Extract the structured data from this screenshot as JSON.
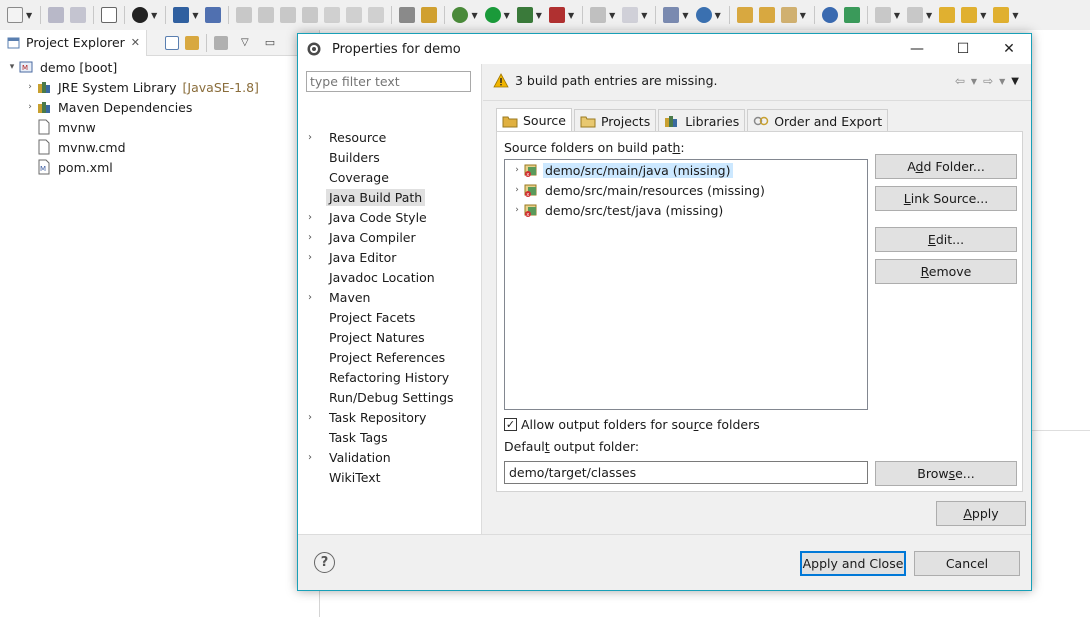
{
  "explorer": {
    "tab_title": "Project Explorer",
    "items": [
      {
        "label": "demo [boot]",
        "suffix": "",
        "level": 0,
        "expanded": true,
        "icon": "maven-project-icon"
      },
      {
        "label": "JRE System Library",
        "suffix": "[JavaSE-1.8]",
        "level": 1,
        "expanded": false,
        "icon": "library-icon"
      },
      {
        "label": "Maven Dependencies",
        "suffix": "",
        "level": 1,
        "expanded": false,
        "icon": "library-icon"
      },
      {
        "label": "mvnw",
        "suffix": "",
        "level": 1,
        "expanded": null,
        "icon": "file-icon"
      },
      {
        "label": "mvnw.cmd",
        "suffix": "",
        "level": 1,
        "expanded": null,
        "icon": "file-icon"
      },
      {
        "label": "pom.xml",
        "suffix": "",
        "level": 1,
        "expanded": null,
        "icon": "xml-file-icon"
      }
    ]
  },
  "dialog": {
    "title": "Properties for demo",
    "filter_placeholder": "type filter text",
    "nav": [
      {
        "label": "Resource",
        "expandable": true
      },
      {
        "label": "Builders",
        "expandable": false
      },
      {
        "label": "Coverage",
        "expandable": false
      },
      {
        "label": "Java Build Path",
        "expandable": false,
        "selected": true
      },
      {
        "label": "Java Code Style",
        "expandable": true
      },
      {
        "label": "Java Compiler",
        "expandable": true
      },
      {
        "label": "Java Editor",
        "expandable": true
      },
      {
        "label": "Javadoc Location",
        "expandable": false
      },
      {
        "label": "Maven",
        "expandable": true
      },
      {
        "label": "Project Facets",
        "expandable": false
      },
      {
        "label": "Project Natures",
        "expandable": false
      },
      {
        "label": "Project References",
        "expandable": false
      },
      {
        "label": "Refactoring History",
        "expandable": false
      },
      {
        "label": "Run/Debug Settings",
        "expandable": false
      },
      {
        "label": "Task Repository",
        "expandable": true
      },
      {
        "label": "Task Tags",
        "expandable": false
      },
      {
        "label": "Validation",
        "expandable": true
      },
      {
        "label": "WikiText",
        "expandable": false
      }
    ],
    "message": "3 build path entries are missing.",
    "tabs": [
      {
        "label": "Source",
        "active": true,
        "icon": "source-folder-icon"
      },
      {
        "label": "Projects",
        "active": false,
        "icon": "projects-icon"
      },
      {
        "label": "Libraries",
        "active": false,
        "icon": "libraries-icon"
      },
      {
        "label": "Order and Export",
        "active": false,
        "icon": "order-export-icon"
      }
    ],
    "source_label": "Source folders on build path:",
    "source_folders": [
      {
        "label": "demo/src/main/java (missing)",
        "selected": true
      },
      {
        "label": "demo/src/main/resources (missing)",
        "selected": false
      },
      {
        "label": "demo/src/test/java (missing)",
        "selected": false
      }
    ],
    "buttons": {
      "add_folder": "Add Folder...",
      "link_source": "Link Source...",
      "edit": "Edit...",
      "remove": "Remove",
      "browse": "Browse...",
      "apply": "Apply",
      "apply_close": "Apply and Close",
      "cancel": "Cancel"
    },
    "allow_output_label": "Allow output folders for source folders",
    "allow_output_checked": true,
    "default_output_label": "Default output folder:",
    "default_output_value": "demo/target/classes"
  },
  "colors": {
    "dialog_border": "#18a0b8",
    "selection": "#cce8ff",
    "default_button_border": "#0078d7",
    "warning": "#f0b400"
  }
}
